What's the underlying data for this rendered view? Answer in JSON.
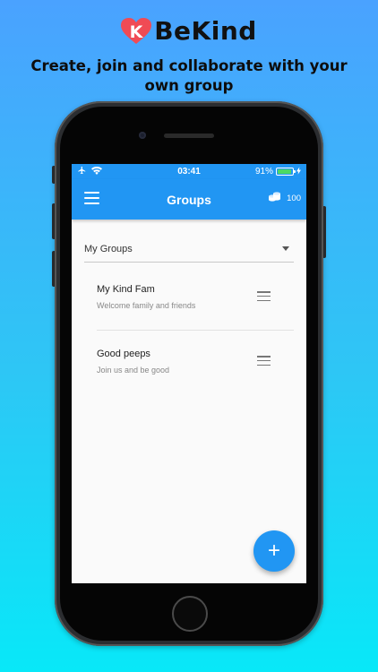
{
  "brand": {
    "logo_letter": "K",
    "name": "BeKind",
    "accent": "#f04b55"
  },
  "tagline": "Create, join and collaborate with your own group",
  "status_bar": {
    "time": "03:41",
    "battery_text": "91%",
    "battery_level": 0.91
  },
  "app_bar": {
    "title": "Groups",
    "coins": "100",
    "color": "#2196f3"
  },
  "group_select": {
    "selected": "My Groups"
  },
  "groups": [
    {
      "title": "My Kind Fam",
      "subtitle": "Welcome family and friends"
    },
    {
      "title": "Good peeps",
      "subtitle": "Join us and be good"
    }
  ],
  "fab": {
    "label": "+"
  },
  "icons": {
    "menu": "menu-icon",
    "coins": "coins-icon",
    "drag": "drag-handle-icon",
    "dropdown": "chevron-down-icon",
    "add": "plus-icon"
  }
}
